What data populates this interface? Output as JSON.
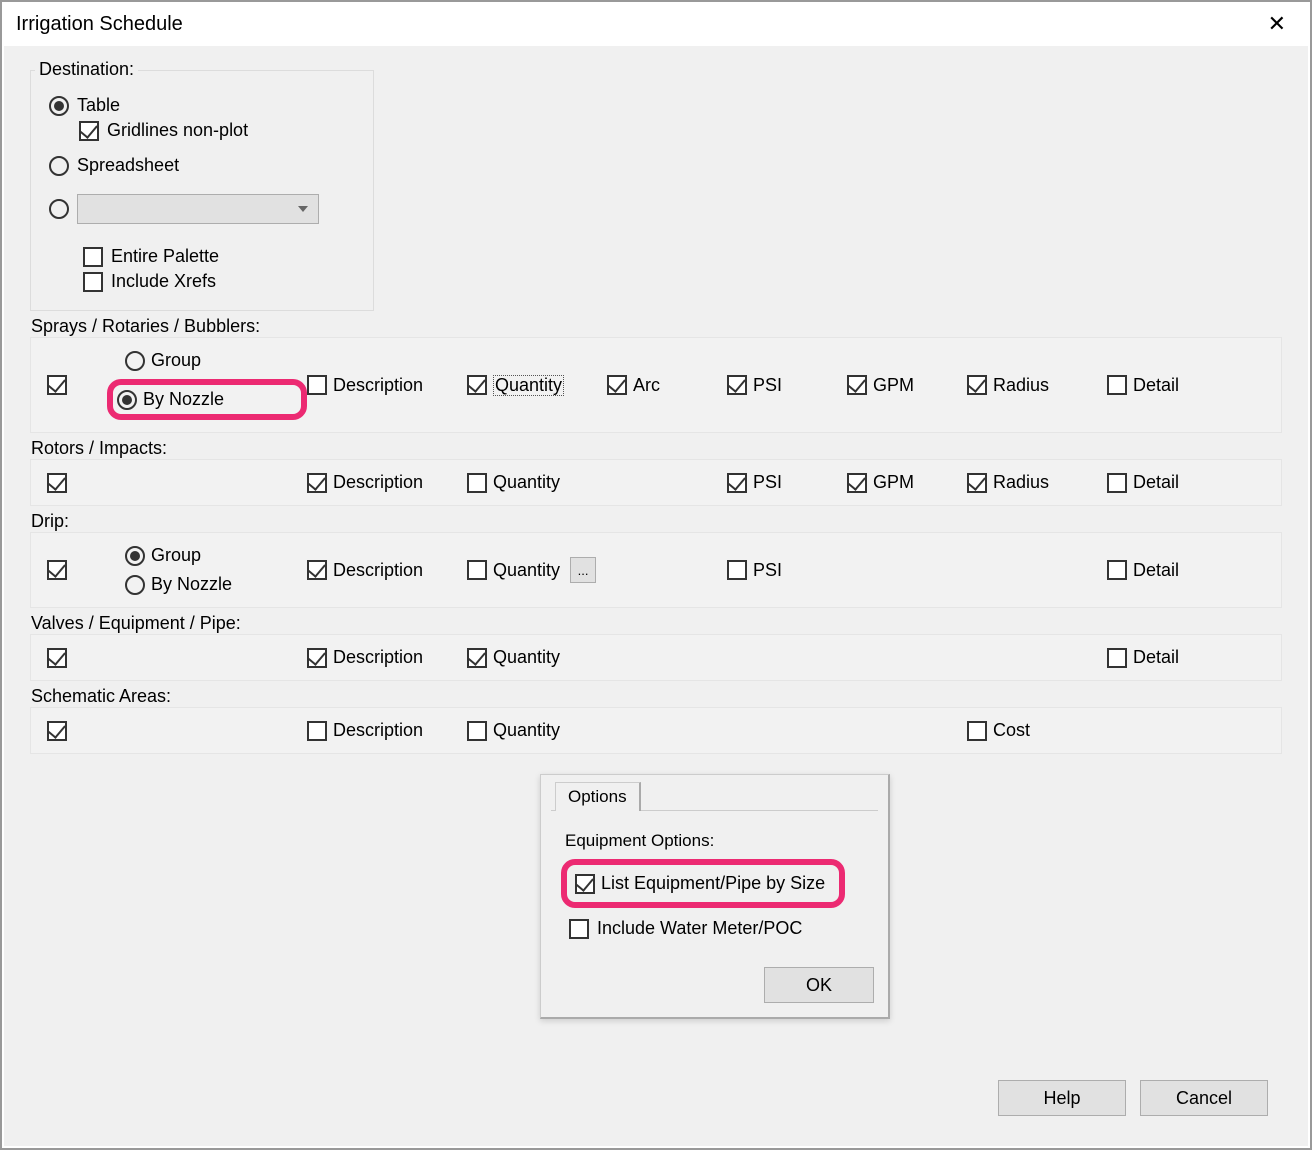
{
  "window": {
    "title": "Irrigation Schedule"
  },
  "destination": {
    "legend": "Destination:",
    "table_label": "Table",
    "gridlines_label": "Gridlines non-plot",
    "spreadsheet_label": "Spreadsheet",
    "entire_palette_label": "Entire Palette",
    "include_xrefs_label": "Include Xrefs",
    "radio_table": true,
    "radio_spreadsheet": false,
    "radio_custom": false,
    "chk_gridlines": true,
    "chk_entire_palette": false,
    "chk_include_xrefs": false
  },
  "columns": {
    "description": "Description",
    "quantity": "Quantity",
    "arc": "Arc",
    "psi": "PSI",
    "gpm": "GPM",
    "radius": "Radius",
    "detail": "Detail",
    "cost": "Cost",
    "group": "Group",
    "by_nozzle": "By Nozzle"
  },
  "rows": {
    "sprays": {
      "title": "Sprays / Rotaries / Bubblers:",
      "enabled": true,
      "group": false,
      "by_nozzle": true,
      "description": false,
      "quantity": true,
      "arc": true,
      "psi": true,
      "gpm": true,
      "radius": true,
      "detail": false
    },
    "rotors": {
      "title": "Rotors / Impacts:",
      "enabled": true,
      "description": true,
      "quantity": false,
      "psi": true,
      "gpm": true,
      "radius": true,
      "detail": false
    },
    "drip": {
      "title": "Drip:",
      "enabled": true,
      "group": true,
      "by_nozzle": false,
      "description": true,
      "quantity": false,
      "psi": false,
      "detail": false,
      "ellipsis": "..."
    },
    "valves": {
      "title": "Valves / Equipment / Pipe:",
      "enabled": true,
      "description": true,
      "quantity": true,
      "detail": false
    },
    "schematic": {
      "title": "Schematic Areas:",
      "enabled": true,
      "description": false,
      "quantity": false,
      "cost": false
    }
  },
  "popup": {
    "tab": "Options",
    "group_label": "Equipment Options:",
    "list_by_size_label": "List Equipment/Pipe by Size",
    "include_meter_label": "Include Water Meter/POC",
    "list_by_size": true,
    "include_meter": false,
    "ok": "OK"
  },
  "buttons": {
    "help": "Help",
    "cancel": "Cancel"
  }
}
